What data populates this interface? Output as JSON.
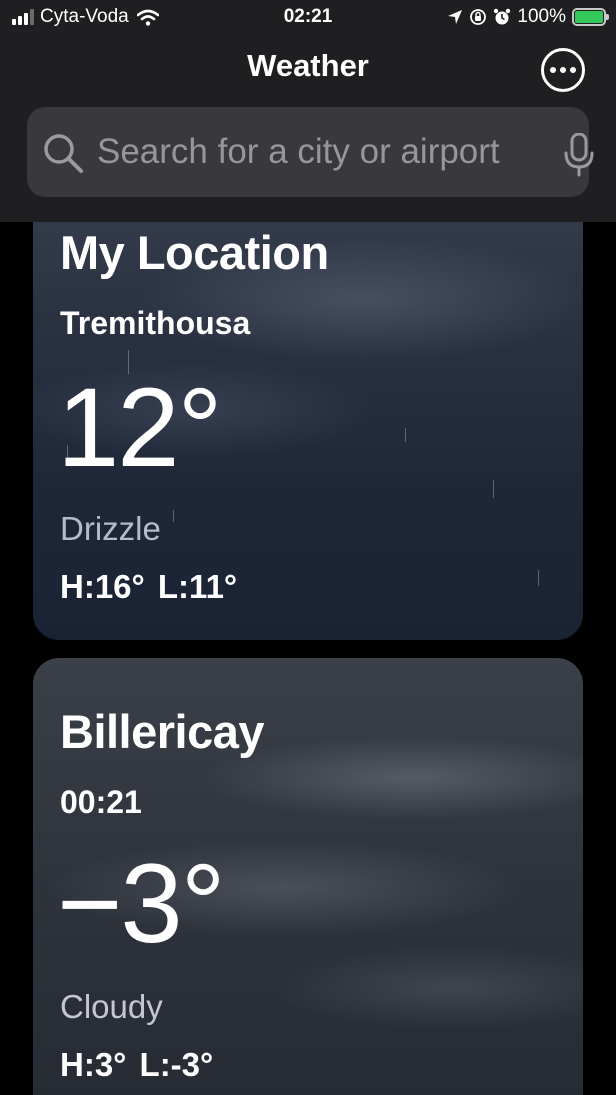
{
  "status_bar": {
    "carrier": "Cyta-Voda",
    "time": "02:21",
    "battery": "100%"
  },
  "nav": {
    "title": "Weather",
    "more_icon": "ellipsis-circle-icon"
  },
  "search": {
    "placeholder": "Search for a city or airport",
    "value": ""
  },
  "cards": [
    {
      "title": "My Location",
      "subtitle": "Tremithousa",
      "temperature": "12°",
      "condition": "Drizzle",
      "high_low": "H:16° L:11°"
    },
    {
      "title": "Billericay",
      "subtitle": "00:21",
      "temperature": "−3°",
      "condition": "Cloudy",
      "high_low": "H:3° L:-3°"
    }
  ],
  "colors": {
    "battery_fill": "#34c759",
    "topbar_bg": "#1f1f21",
    "search_bg": "#39393c"
  }
}
